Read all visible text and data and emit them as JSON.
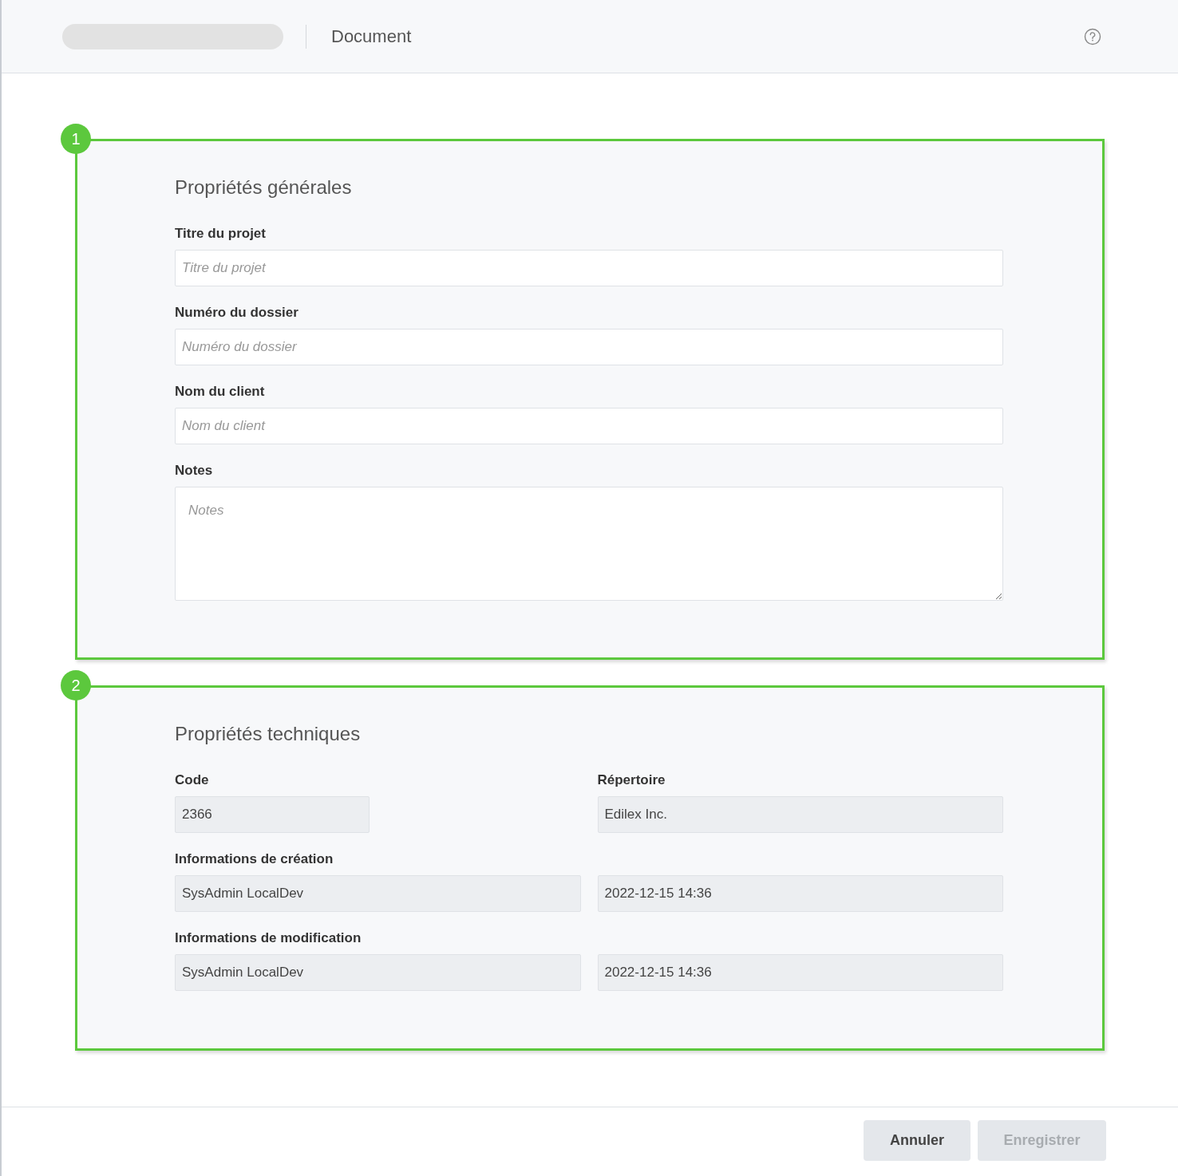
{
  "header": {
    "title": "Document"
  },
  "sections": [
    {
      "badge": "1",
      "title": "Propriétés générales",
      "fields": [
        {
          "kind": "text",
          "label": "Titre du projet",
          "placeholder": "Titre du projet"
        },
        {
          "kind": "text",
          "label": "Numéro du dossier",
          "placeholder": "Numéro du dossier"
        },
        {
          "kind": "text",
          "label": "Nom du client",
          "placeholder": "Nom du client"
        },
        {
          "kind": "textarea",
          "label": "Notes",
          "placeholder": "Notes"
        }
      ]
    },
    {
      "badge": "2",
      "title": "Propriétés techniques",
      "rows": [
        {
          "kind": "pair",
          "items": [
            {
              "label": "Code",
              "value": "2366"
            },
            {
              "label": "Répertoire",
              "value": "Edilex Inc."
            }
          ]
        },
        {
          "kind": "shared",
          "label": "Informations de création",
          "values": [
            "SysAdmin LocalDev",
            "2022-12-15 14:36"
          ]
        },
        {
          "kind": "shared",
          "label": "Informations de modification",
          "values": [
            "SysAdmin LocalDev",
            "2022-12-15 14:36"
          ]
        }
      ]
    }
  ],
  "buttons": [
    {
      "label": "Annuler",
      "disabled": false
    },
    {
      "label": "Enregistrer",
      "disabled": true
    }
  ]
}
